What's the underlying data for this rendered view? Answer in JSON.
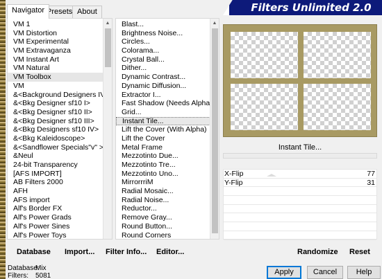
{
  "title": "Filters Unlimited 2.0",
  "tabs": [
    "Navigator",
    "Presets",
    "About"
  ],
  "categories": [
    "VM 1",
    "VM Distortion",
    "VM Experimental",
    "VM Extravaganza",
    "VM Instant Art",
    "VM Natural",
    "VM Toolbox",
    "VM",
    "&<Background Designers IV>",
    "&<Bkg Designer sf10 I>",
    "&<Bkg Designer sf10 II>",
    "&<Bkg Designer sf10 III>",
    "&<Bkg Designers sf10 IV>",
    "&<Bkg Kaleidoscope>",
    "&<Sandflower Specials\"v\" >",
    "&Neul",
    "24-bit Transparency",
    "[AFS IMPORT]",
    "AB Filters 2000",
    "AFH",
    "AFS import",
    "Alf's Border FX",
    "Alf's Power Grads",
    "Alf's Power Sines",
    "Alf's Power Toys"
  ],
  "selected_category": "VM Toolbox",
  "filters": [
    "Blast...",
    "Brightness Noise...",
    "Circles...",
    "Colorama...",
    "Crystal Ball...",
    "Dither...",
    "Dynamic Contrast...",
    "Dynamic Diffusion...",
    "Extractor I...",
    "Fast Shadow (Needs Alpha)",
    "Grid...",
    "Instant Tile...",
    "Lift the Cover (With Alpha)",
    "Lift the Cover",
    "Metal Frame",
    "Mezzotinto Due...",
    "Mezzotinto Tre...",
    "Mezzotinto Uno...",
    "MirrorrriM",
    "Radial Mosaic...",
    "Radial Noise...",
    "Reductor...",
    "Remove Gray...",
    "Round Button...",
    "Round Corners"
  ],
  "selected_filter": "Instant Tile...",
  "filter_name_label": "Instant Tile...",
  "params": [
    {
      "label": "X-Flip",
      "value": "77"
    },
    {
      "label": "Y-Flip",
      "value": "31"
    }
  ],
  "toolbar": {
    "database": "Database",
    "import": "Import...",
    "filter_info": "Filter Info...",
    "editor": "Editor...",
    "randomize": "Randomize",
    "reset": "Reset"
  },
  "info": {
    "database_label": "Database:",
    "database_value": "Mix",
    "filters_label": "Filters:",
    "filters_value": "5081"
  },
  "buttons": {
    "apply": "Apply",
    "cancel": "Cancel",
    "help": "Help"
  },
  "colors": {
    "frame": "#a89a63",
    "titlebar": "#0d1a7a"
  }
}
